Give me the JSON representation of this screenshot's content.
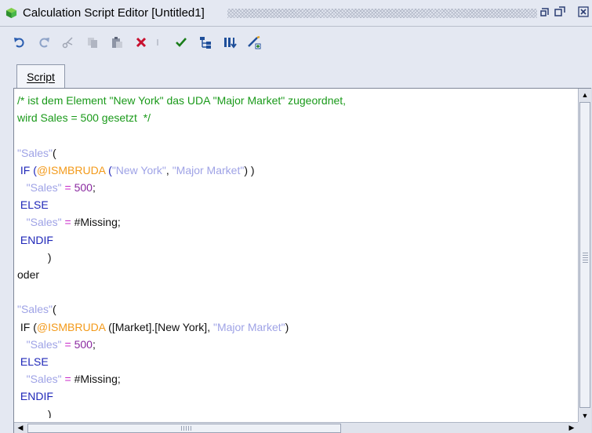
{
  "window": {
    "title": "Calculation Script Editor [Untitled1]",
    "icons": {
      "app": "cube-icon",
      "restore": "restore-icon",
      "maximize": "maximize-icon",
      "close": "close-icon"
    }
  },
  "toolbar": {
    "icons": [
      "undo-icon",
      "redo-icon",
      "cut-icon",
      "copy-icon",
      "paste-icon",
      "delete-icon",
      "separator",
      "validate-icon",
      "outline-icon",
      "insert-member-icon",
      "function-icon"
    ]
  },
  "tabs": {
    "script_label": "Script"
  },
  "colors": {
    "comment": "#1a9a1a",
    "string": "#9fa3e6",
    "keyword": "#1f27b8",
    "function": "#f39a1a",
    "operator": "#c828c8",
    "number": "#8a2aa0"
  },
  "code": {
    "l1": "/* ist dem Element \"New York\" das UDA \"Major Market\" zugeordnet,",
    "l2": "wird Sales = 500 gesetzt  */",
    "sales": "\"Sales\"",
    "paren_open": "(",
    "paren_close": ")",
    "if": "IF",
    "else": "ELSE",
    "endif": "ENDIF",
    "fn": "@ISMBRUDA",
    "ny_str": "\"New York\"",
    "major_market": "\"Major Market\"",
    "ny_member": "[Market].[New York]",
    "eq": "=",
    "num500": "500",
    "missing": "#Missing;",
    "oder": "oder"
  }
}
